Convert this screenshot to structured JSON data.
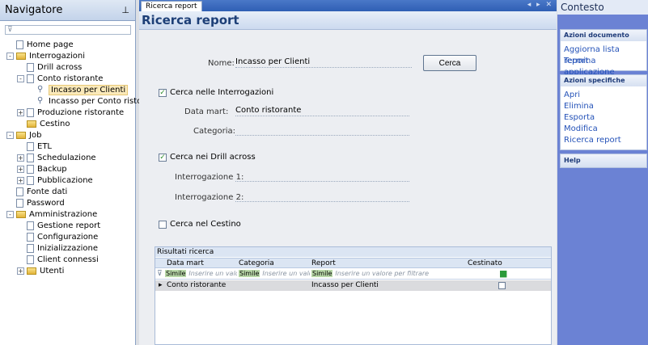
{
  "navigator": {
    "title": "Navigatore",
    "pin": "ꟷ",
    "filter_value": "",
    "tree": [
      {
        "label": "Home page",
        "indent": 0,
        "icon": "doc",
        "exp": ""
      },
      {
        "label": "Interrogazioni",
        "indent": 0,
        "icon": "folder",
        "exp": "-"
      },
      {
        "label": "Drill across",
        "indent": 1,
        "icon": "doc",
        "exp": ""
      },
      {
        "label": "Conto ristorante",
        "indent": 1,
        "icon": "doc",
        "exp": "-"
      },
      {
        "label": "Incasso per Clienti",
        "indent": 2,
        "icon": "search",
        "exp": "",
        "selected": true
      },
      {
        "label": "Incasso per Conto ristor",
        "indent": 2,
        "icon": "search",
        "exp": ""
      },
      {
        "label": "Produzione ristorante",
        "indent": 1,
        "icon": "doc",
        "exp": "+"
      },
      {
        "label": "Cestino",
        "indent": 1,
        "icon": "folder",
        "exp": ""
      },
      {
        "label": "Job",
        "indent": 0,
        "icon": "folder",
        "exp": "-"
      },
      {
        "label": "ETL",
        "indent": 1,
        "icon": "doc",
        "exp": ""
      },
      {
        "label": "Schedulazione",
        "indent": 1,
        "icon": "doc",
        "exp": "+"
      },
      {
        "label": "Backup",
        "indent": 1,
        "icon": "doc",
        "exp": "+"
      },
      {
        "label": "Pubblicazione",
        "indent": 1,
        "icon": "doc",
        "exp": "+"
      },
      {
        "label": "Fonte dati",
        "indent": 0,
        "icon": "doc",
        "exp": ""
      },
      {
        "label": "Password",
        "indent": 0,
        "icon": "doc",
        "exp": ""
      },
      {
        "label": "Amministrazione",
        "indent": 0,
        "icon": "folder",
        "exp": "-"
      },
      {
        "label": "Gestione report",
        "indent": 1,
        "icon": "doc",
        "exp": ""
      },
      {
        "label": "Configurazione",
        "indent": 1,
        "icon": "doc",
        "exp": ""
      },
      {
        "label": "Inizializzazione",
        "indent": 1,
        "icon": "doc",
        "exp": ""
      },
      {
        "label": "Client connessi",
        "indent": 1,
        "icon": "doc",
        "exp": ""
      },
      {
        "label": "Utenti",
        "indent": 1,
        "icon": "folder",
        "exp": "+"
      }
    ]
  },
  "main": {
    "tab_label": "Ricerca report",
    "tab_controls": "◂ ▸ ✕",
    "title": "Ricerca report",
    "nome_label": "Nome:",
    "nome_value": "Incasso per Clienti",
    "cerca_button": "Cerca",
    "cerca_interrogazioni_label": "Cerca nelle Interrogazioni",
    "cerca_interrogazioni_checked": "✓",
    "datamart_label": "Data mart:",
    "datamart_value": "Conto ristorante",
    "categoria_label": "Categoria:",
    "categoria_value": "",
    "cerca_drill_label": "Cerca nei Drill across",
    "cerca_drill_checked": "✓",
    "interrogazione1_label": "Interrogazione 1:",
    "interrogazione1_value": "",
    "interrogazione2_label": "Interrogazione 2:",
    "interrogazione2_value": "",
    "cerca_cestino_label": "Cerca nel Cestino",
    "cerca_cestino_checked": ""
  },
  "results": {
    "title": "Risultati ricerca",
    "columns": [
      "Data mart",
      "Categoria",
      "Report",
      "Cestinato"
    ],
    "filter": {
      "op": "Simile",
      "ph1": "Inserire un valore",
      "ph2": "Inserire un valore",
      "ph3": "Inserire un valore per filtrare",
      "cestinato_mark": "■"
    },
    "rows": [
      {
        "indicator": "▸",
        "datamart": "Conto ristorante",
        "categoria": "",
        "report": "Incasso per Clienti",
        "cestinato": ""
      }
    ]
  },
  "contesto": {
    "title": "Contesto",
    "azioni_documento_title": "Azioni documento",
    "azioni_documento": [
      "Aggiorna lista report",
      "Termina applicazione"
    ],
    "azioni_specifiche_title": "Azioni specifiche",
    "azioni_specifiche": [
      "Apri",
      "Elimina",
      "Esporta",
      "Modifica",
      "Ricerca report"
    ],
    "help_title": "Help"
  },
  "colors": {
    "accent": "#2f5fb4",
    "context_bg": "#6b82d4",
    "link": "#2452b8",
    "selection": "#fae9b9"
  }
}
